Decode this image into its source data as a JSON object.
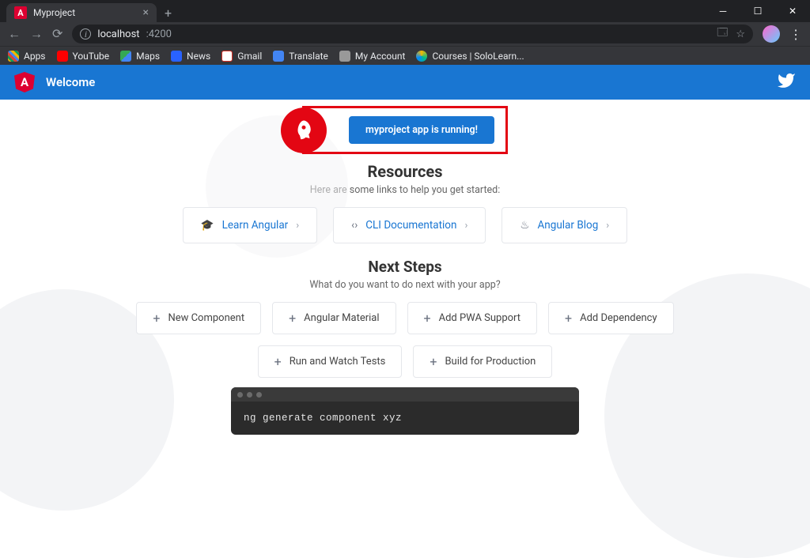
{
  "browser": {
    "tab_title": "Myproject",
    "url_host": "localhost",
    "url_port": ":4200"
  },
  "bookmarks": [
    {
      "label": "Apps"
    },
    {
      "label": "YouTube"
    },
    {
      "label": "Maps"
    },
    {
      "label": "News"
    },
    {
      "label": "Gmail"
    },
    {
      "label": "Translate"
    },
    {
      "label": "My Account"
    },
    {
      "label": "Courses | SoloLearn..."
    }
  ],
  "toolbar": {
    "welcome": "Welcome"
  },
  "banner": {
    "text": "myproject app is running!"
  },
  "resources": {
    "title": "Resources",
    "sub": "Here are some links to help you get started:",
    "cards": [
      "Learn Angular",
      "CLI Documentation",
      "Angular Blog"
    ]
  },
  "next_steps": {
    "title": "Next Steps",
    "sub": "What do you want to do next with your app?",
    "items": [
      "New Component",
      "Angular Material",
      "Add PWA Support",
      "Add Dependency",
      "Run and Watch Tests",
      "Build for Production"
    ]
  },
  "terminal": {
    "command": "ng generate component xyz"
  }
}
